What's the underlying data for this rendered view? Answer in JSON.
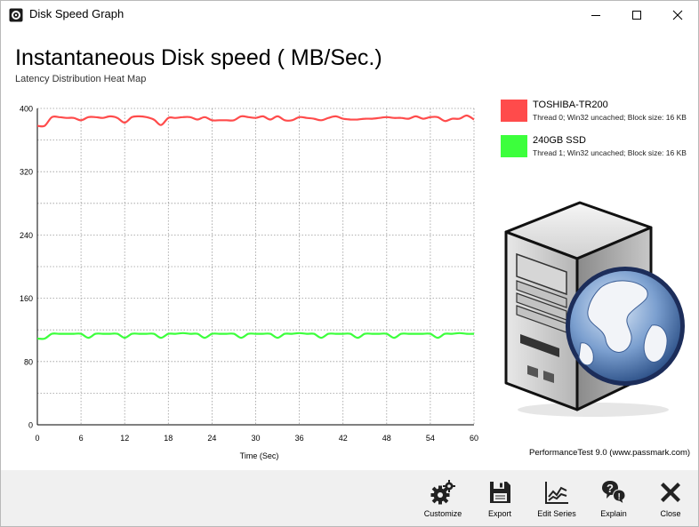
{
  "window": {
    "title": "Disk Speed Graph"
  },
  "header": {
    "title": "Instantaneous Disk speed ( MB/Sec.)",
    "subtitle": "Latency Distribution Heat Map"
  },
  "legend": [
    {
      "name": "TOSHIBA-TR200",
      "detail": "Thread 0; Win32 uncached; Block size: 16 KB",
      "color": "#ff4b4b"
    },
    {
      "name": "240GB SSD",
      "detail": "Thread 1; Win32 uncached; Block size: 16 KB",
      "color": "#3cff3c"
    }
  ],
  "credit": "PerformanceTest 9.0 (www.passmark.com)",
  "toolbar": {
    "customize": "Customize",
    "export": "Export",
    "edit_series": "Edit Series",
    "explain": "Explain",
    "close": "Close"
  },
  "chart_data": {
    "type": "line",
    "title": "",
    "xlabel": "Time (Sec)",
    "ylabel": "",
    "xlim": [
      0,
      60
    ],
    "ylim": [
      0,
      400
    ],
    "xticks": [
      "0",
      "6",
      "12",
      "18",
      "24",
      "30",
      "36",
      "42",
      "48",
      "54",
      "60"
    ],
    "yticks": [
      "0",
      "80",
      "160",
      "240",
      "320",
      "400"
    ],
    "grid": true,
    "x": [
      0,
      1,
      2,
      3,
      4,
      5,
      6,
      7,
      8,
      9,
      10,
      11,
      12,
      13,
      14,
      15,
      16,
      17,
      18,
      19,
      20,
      21,
      22,
      23,
      24,
      25,
      26,
      27,
      28,
      29,
      30,
      31,
      32,
      33,
      34,
      35,
      36,
      37,
      38,
      39,
      40,
      41,
      42,
      43,
      44,
      45,
      46,
      47,
      48,
      49,
      50,
      51,
      52,
      53,
      54,
      55,
      56,
      57,
      58,
      59,
      60
    ],
    "series": [
      {
        "name": "TOSHIBA-TR200",
        "color": "#ff4b4b",
        "values": [
          378,
          378,
          389,
          389,
          388,
          388,
          385,
          389,
          389,
          388,
          390,
          388,
          382,
          389,
          390,
          389,
          386,
          379,
          388,
          388,
          389,
          389,
          386,
          389,
          385,
          385,
          385,
          385,
          390,
          389,
          388,
          390,
          386,
          390,
          385,
          385,
          389,
          388,
          387,
          385,
          388,
          390,
          387,
          386,
          386,
          387,
          387,
          388,
          389,
          388,
          388,
          387,
          390,
          387,
          389,
          389,
          384,
          387,
          387,
          391,
          386
        ],
        "smooth": true
      },
      {
        "name": "240GB SSD",
        "color": "#3cff3c",
        "values": [
          109,
          109,
          115,
          115,
          115,
          115,
          115,
          110,
          115,
          115,
          115,
          115,
          110,
          115,
          115,
          115,
          115,
          110,
          115,
          115,
          116,
          115,
          115,
          110,
          115,
          115,
          115,
          115,
          110,
          115,
          115,
          115,
          115,
          110,
          115,
          115,
          116,
          115,
          115,
          110,
          115,
          115,
          115,
          115,
          110,
          115,
          115,
          115,
          115,
          110,
          115,
          115,
          115,
          115,
          115,
          110,
          115,
          115,
          116,
          115,
          115
        ],
        "smooth": true
      }
    ]
  }
}
